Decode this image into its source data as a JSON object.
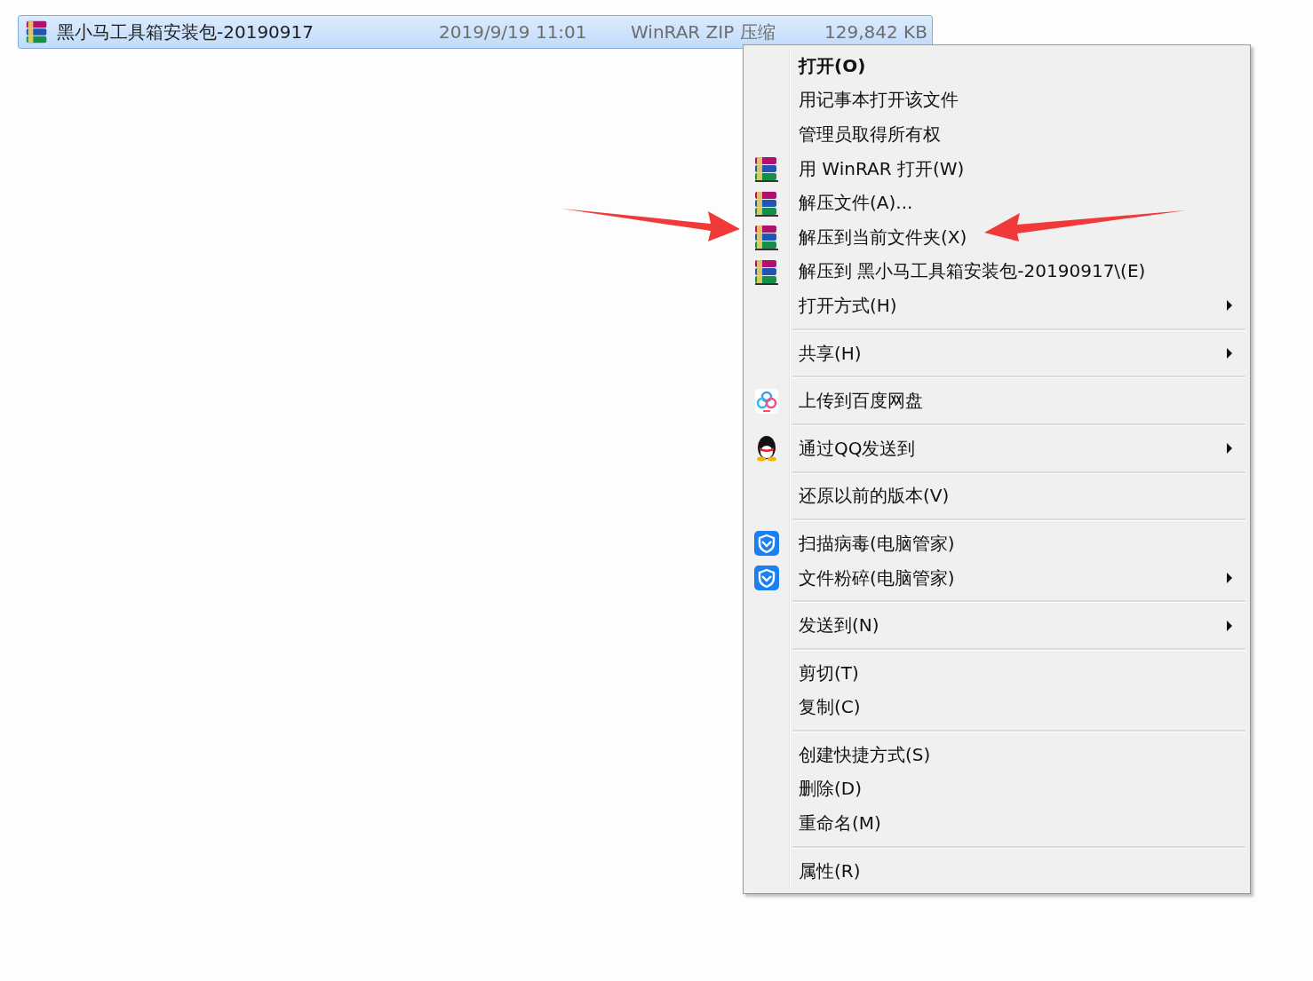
{
  "file_row": {
    "name": "黑小马工具箱安装包-20190917",
    "date": "2019/9/19 11:01",
    "type": "WinRAR ZIP 压缩",
    "size": "129,842 KB",
    "selected": true
  },
  "context_menu": {
    "groups": [
      {
        "items": [
          {
            "label": "打开(O)",
            "default": true,
            "submenu": false
          },
          {
            "label": "用记事本打开该文件",
            "default": false,
            "submenu": false
          },
          {
            "label": "管理员取得所有权",
            "default": false,
            "submenu": false
          },
          {
            "label": "用 WinRAR 打开(W)",
            "default": false,
            "kind": "archive",
            "submenu": false
          },
          {
            "label": "解压文件(A)...",
            "default": false,
            "kind": "archive",
            "submenu": false
          },
          {
            "label": "解压到当前文件夹(X)",
            "default": false,
            "kind": "archive",
            "submenu": false
          },
          {
            "label": "解压到 黑小马工具箱安装包-20190917\\(E)",
            "default": false,
            "kind": "archive",
            "submenu": false
          },
          {
            "label": "打开方式(H)",
            "default": false,
            "submenu": true
          }
        ]
      },
      {
        "items": [
          {
            "label": "共享(H)",
            "default": false,
            "submenu": true
          }
        ]
      },
      {
        "items": [
          {
            "label": "上传到百度网盘",
            "default": false,
            "kind": "cloud",
            "submenu": false
          }
        ]
      },
      {
        "items": [
          {
            "label": "通过QQ发送到",
            "default": false,
            "kind": "penguin",
            "submenu": true
          }
        ]
      },
      {
        "items": [
          {
            "label": "还原以前的版本(V)",
            "default": false,
            "submenu": false
          }
        ]
      },
      {
        "items": [
          {
            "label": "扫描病毒(电脑管家)",
            "default": false,
            "kind": "shield",
            "submenu": false
          },
          {
            "label": "文件粉碎(电脑管家)",
            "default": false,
            "kind": "shield",
            "submenu": true
          }
        ]
      },
      {
        "items": [
          {
            "label": "发送到(N)",
            "default": false,
            "submenu": true
          }
        ]
      },
      {
        "items": [
          {
            "label": "剪切(T)",
            "default": false,
            "submenu": false
          },
          {
            "label": "复制(C)",
            "default": false,
            "submenu": false
          }
        ]
      },
      {
        "items": [
          {
            "label": "创建快捷方式(S)",
            "default": false,
            "submenu": false
          },
          {
            "label": "删除(D)",
            "default": false,
            "submenu": false
          },
          {
            "label": "重命名(M)",
            "default": false,
            "submenu": false
          }
        ]
      },
      {
        "items": [
          {
            "label": "属性(R)",
            "default": false,
            "submenu": false
          }
        ]
      }
    ]
  }
}
